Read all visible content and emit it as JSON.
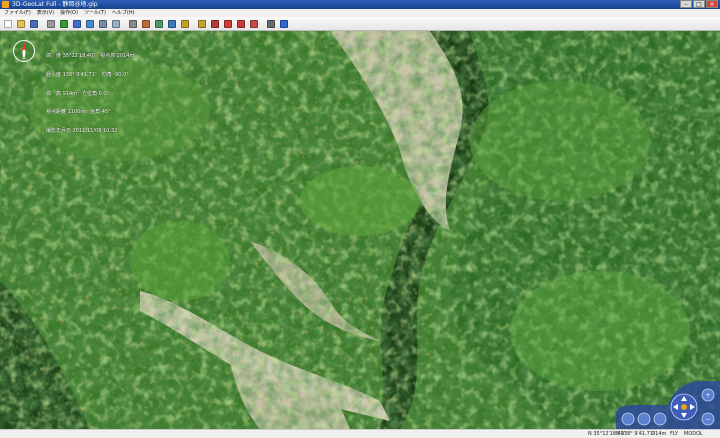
{
  "window": {
    "title": "3D-GeoLat Full - 静岡谷地.glp",
    "minimize": "0",
    "maximize": "1",
    "close": "r"
  },
  "menu": [
    "ファイル(F)",
    "表示(V)",
    "操作(O)",
    "ツール(T)",
    "ヘルプ(H)"
  ],
  "toolbar": [
    {
      "name": "new-file-icon",
      "color": "#ffffff"
    },
    {
      "name": "open-folder-icon",
      "color": "#e8c050"
    },
    {
      "name": "save-icon",
      "color": "#4a6fb8"
    },
    {
      "name": "print-icon",
      "color": "#9a9a9a"
    },
    {
      "name": "export-image-icon",
      "color": "#3a9a3a"
    },
    {
      "name": "import-icon",
      "color": "#3a70c8"
    },
    {
      "name": "rotate-view-icon",
      "color": "#4a88c8"
    },
    {
      "name": "window-layout-icon",
      "color": "#7a8aa0"
    },
    {
      "name": "copy-view-icon",
      "color": "#9ab0c8"
    },
    {
      "name": "cube-3d-icon",
      "color": "#8a8a8a"
    },
    {
      "name": "layer-icon",
      "color": "#c06a3a"
    },
    {
      "name": "terrain-icon",
      "color": "#4a9a6a"
    },
    {
      "name": "texture-icon",
      "color": "#3a7ab8"
    },
    {
      "name": "light-icon",
      "color": "#c8a030"
    },
    {
      "name": "profile-chart-icon",
      "color": "#c8a030"
    },
    {
      "name": "measure-icon",
      "color": "#b83a3a"
    },
    {
      "name": "marker-icon",
      "color": "#d23a3a"
    },
    {
      "name": "zoom-area-icon",
      "color": "#c83a3a"
    },
    {
      "name": "search-point-icon",
      "color": "#c84a4a"
    },
    {
      "name": "wrench-icon",
      "color": "#6a6a6a"
    },
    {
      "name": "help-icon",
      "color": "#2a6ad0"
    }
  ],
  "overlay_lines": [
    "緯　度 35°12′18.40″　視点高 2014m",
    "経　度 138° 9′41.71″　仰角 -90.0°",
    "標　高 914m　方位角 0.0°",
    "視点距離 1100m　画角 45°",
    "撮影年月日 2011/11/08 10:32"
  ],
  "status": {
    "lat": "N 35°12′18.40″",
    "lon": "E 138° 9′41.71″",
    "elev": "914m",
    "mode": "FLY",
    "state": "MODOL"
  },
  "colors": {
    "forest_dark": "#1f4a1c",
    "forest": "#3e7d2c",
    "forest_light": "#6fae45",
    "landslide": "#c9c6ad",
    "autumn": "#b8652a",
    "navpad": "#2d4a9a"
  }
}
